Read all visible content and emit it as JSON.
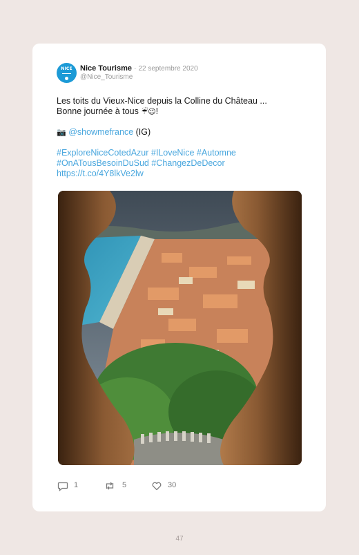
{
  "post": {
    "author": {
      "name": "Nice Tourisme",
      "handle": "@Nice_Tourisme",
      "avatar_text": "NICE",
      "separator": "·",
      "date": "22 septembre 2020"
    },
    "text": {
      "line1": "Les toits du Vieux-Nice depuis la Colline du Château ...",
      "line2_prefix": "Bonne journée à tous ",
      "line2_emojis": "☔😉",
      "line2_suffix": "!",
      "camera_icon": "📷",
      "mention": "@showmefrance",
      "mention_suffix": " (IG)",
      "hashtags_line1": "#ExploreNiceCotedAzur #ILoveNice #Automne",
      "hashtags_line2": "#OnATousBesoinDuSud #ChangezDeDecor",
      "url": "https://t.co/4Y8lkVe2lw"
    },
    "image": {
      "icon": "photo-nice-rooftops"
    },
    "actions": {
      "replies": "1",
      "retweets": "5",
      "likes": "30"
    }
  },
  "page": {
    "number": "47"
  },
  "colors": {
    "background": "#efe7e4",
    "card": "#ffffff",
    "link": "#4aa7de",
    "brand": "#1c9ad6",
    "muted": "#9a9a9a"
  }
}
